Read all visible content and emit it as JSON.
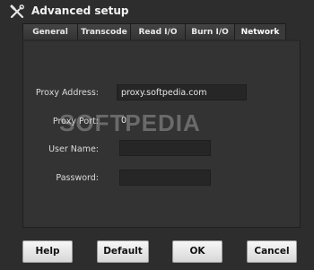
{
  "window": {
    "title": "Advanced setup",
    "icon": "tools-icon"
  },
  "tabs": [
    {
      "label": "General",
      "active": false
    },
    {
      "label": "Transcode",
      "active": false
    },
    {
      "label": "Read I/O",
      "active": false
    },
    {
      "label": "Burn I/O",
      "active": false
    },
    {
      "label": "Network",
      "active": true
    }
  ],
  "network": {
    "proxy_address": {
      "label": "Proxy Address:",
      "value": "proxy.softpedia.com"
    },
    "proxy_port": {
      "label": "Proxy Port:",
      "value": "0"
    },
    "user_name": {
      "label": "User Name:",
      "value": ""
    },
    "password": {
      "label": "Password:",
      "value": ""
    }
  },
  "watermark": "SOFTPEDIA",
  "buttons": {
    "help": "Help",
    "default": "Default",
    "ok": "OK",
    "cancel": "Cancel"
  }
}
